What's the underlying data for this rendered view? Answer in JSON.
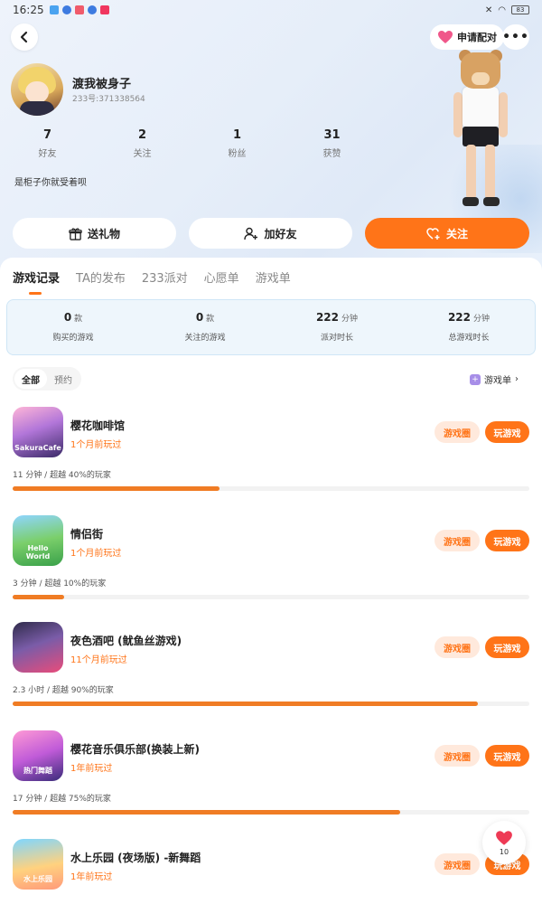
{
  "status_bar": {
    "time": "16:25",
    "battery": "83"
  },
  "header": {
    "pair_label": "申请配对"
  },
  "profile": {
    "name": "渡我被身子",
    "uid": "233号:371338564",
    "bio": "是柜子你就受着呗",
    "stats": [
      {
        "value": "7",
        "label": "好友"
      },
      {
        "value": "2",
        "label": "关注"
      },
      {
        "value": "1",
        "label": "粉丝"
      },
      {
        "value": "31",
        "label": "获赞"
      }
    ]
  },
  "actions": {
    "gift": "送礼物",
    "add_friend": "加好友",
    "follow": "关注"
  },
  "tabs": [
    {
      "label": "游戏记录",
      "active": true
    },
    {
      "label": "TA的发布",
      "active": false
    },
    {
      "label": "233派对",
      "active": false
    },
    {
      "label": "心愿单",
      "active": false
    },
    {
      "label": "游戏单",
      "active": false
    }
  ],
  "summary": [
    {
      "value": "0",
      "unit": "款",
      "label": "购买的游戏"
    },
    {
      "value": "0",
      "unit": "款",
      "label": "关注的游戏"
    },
    {
      "value": "222",
      "unit": "分钟",
      "label": "派对时长"
    },
    {
      "value": "222",
      "unit": "分钟",
      "label": "总游戏时长"
    }
  ],
  "filters": [
    {
      "label": "全部",
      "active": true
    },
    {
      "label": "预约",
      "active": false
    }
  ],
  "game_list_link": {
    "icon": "game-list-icon",
    "label": "游戏单"
  },
  "game_buttons": {
    "circle": "游戏圈",
    "play": "玩游戏"
  },
  "games": [
    {
      "title": "樱花咖啡馆",
      "played": "1个月前玩过",
      "meta": "11 分钟 / 超越 40%的玩家",
      "progress": 0.4,
      "icon_text": "SakuraCafe"
    },
    {
      "title": "情侣街",
      "played": "1个月前玩过",
      "meta": "3 分钟 / 超越 10%的玩家",
      "progress": 0.1,
      "icon_text": "Hello World"
    },
    {
      "title": "夜色酒吧 (鱿鱼丝游戏)",
      "played": "11个月前玩过",
      "meta": "2.3 小时 / 超越 90%的玩家",
      "progress": 0.9,
      "icon_text": ""
    },
    {
      "title": "樱花音乐俱乐部(换装上新)",
      "played": "1年前玩过",
      "meta": "17 分钟 / 超越 75%的玩家",
      "progress": 0.75,
      "icon_text": "热门舞蹈"
    },
    {
      "title": "水上乐园 (夜场版) -新舞蹈",
      "played": "1年前玩过",
      "meta": "",
      "progress": 0,
      "icon_text": "水上乐园"
    }
  ],
  "like_float": {
    "count": "10"
  },
  "colors": {
    "accent": "#ff7418",
    "accent_light": "#ffe9dc",
    "summary_bg": "#eef6fc"
  }
}
